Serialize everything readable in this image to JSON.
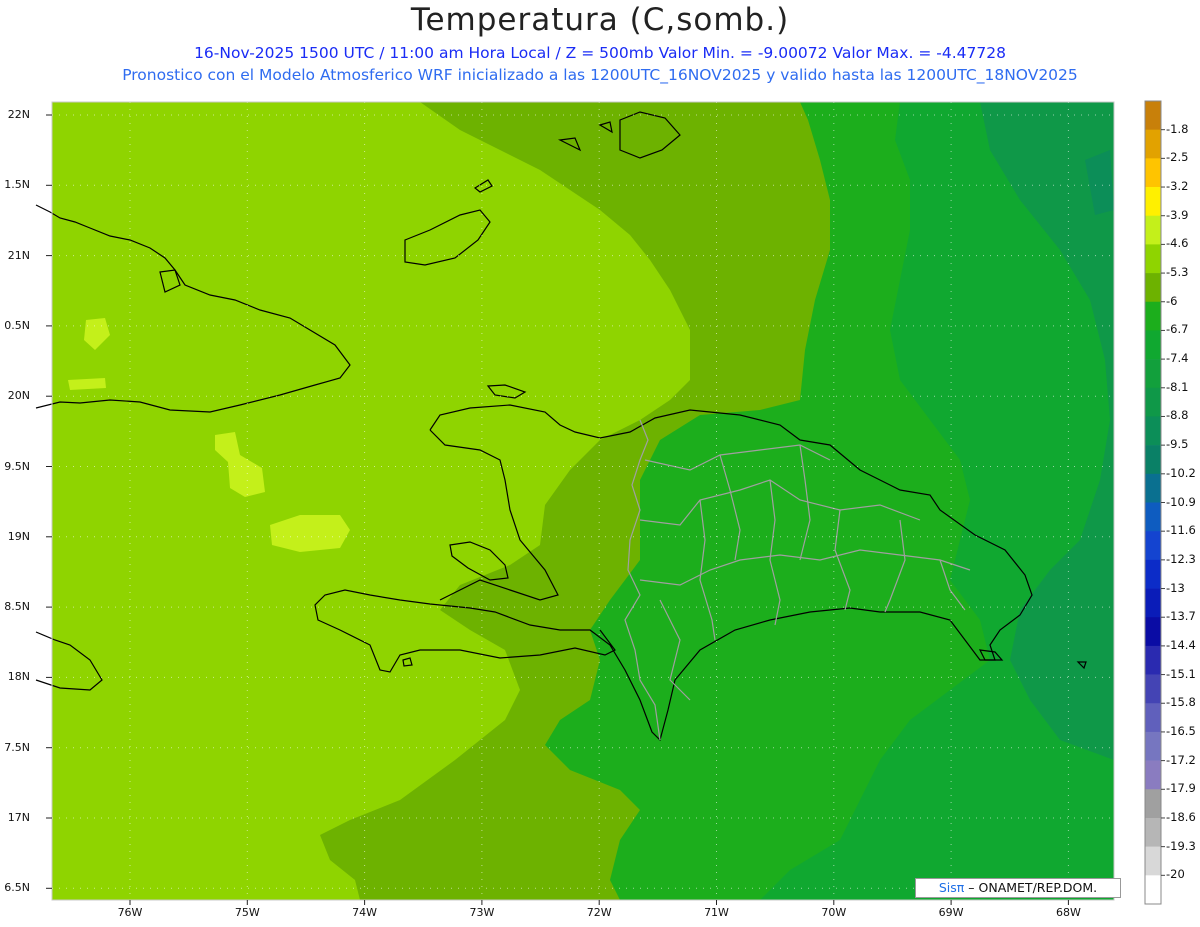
{
  "header": {
    "title": "Temperatura (C,somb.)",
    "line1": "16-Nov-2025  1500 UTC / 11:00 am Hora Local / Z = 500mb  Valor Min. = -9.00072  Valor Max. = -4.47728",
    "line2": "Pronostico con el Modelo Atmosferico WRF inicializado a las 1200UTC_16NOV2025 y valido hasta las  1200UTC_18NOV2025"
  },
  "axes": {
    "lat_labels": [
      "22N",
      "1.5N",
      "21N",
      "0.5N",
      "20N",
      "9.5N",
      "19N",
      "8.5N",
      "18N",
      "7.5N",
      "17N",
      "6.5N"
    ],
    "lon_labels": [
      "76W",
      "75W",
      "74W",
      "73W",
      "72W",
      "71W",
      "70W",
      "69W",
      "68W"
    ]
  },
  "colorbar": {
    "labels": [
      "-1.8",
      "-2.5",
      "-3.2",
      "-3.9",
      "-4.6",
      "-5.3",
      "-6",
      "-6.7",
      "-7.4",
      "-8.1",
      "-8.8",
      "-9.5",
      "-10.2",
      "-10.9",
      "-11.6",
      "-12.3",
      "-13",
      "-13.7",
      "-14.4",
      "-15.1",
      "-15.8",
      "-16.5",
      "-17.2",
      "-17.9",
      "-18.6",
      "-19.3",
      "-20"
    ],
    "colors": [
      "#c8800a",
      "#e2a200",
      "#ffc400",
      "#fff000",
      "#c4f01a",
      "#8fd400",
      "#6db200",
      "#1cae1c",
      "#10a830",
      "#12a03c",
      "#0f9848",
      "#0c8e58",
      "#0a8066",
      "#0a7090",
      "#0e5cc0",
      "#1444d0",
      "#0c2cc8",
      "#0a1cb8",
      "#0a0ca4",
      "#2a2ab0",
      "#4444b4",
      "#6060bc",
      "#7676c0",
      "#8a7cc0",
      "#a0a0a0",
      "#b6b6b6",
      "#d8d8d8",
      "#ffffff"
    ]
  },
  "map": {
    "colors": {
      "warm": "#8fd400",
      "mid": "#6db200",
      "cool": "#1cae1c",
      "cooler": "#10a830",
      "coolest": "#0f9848",
      "patch": "#c4f01a",
      "coast": "#000000",
      "border": "#a0a0a0"
    }
  },
  "credit": {
    "sis": "Sisπ",
    "rest": "– ONAMET/REP.DOM."
  }
}
